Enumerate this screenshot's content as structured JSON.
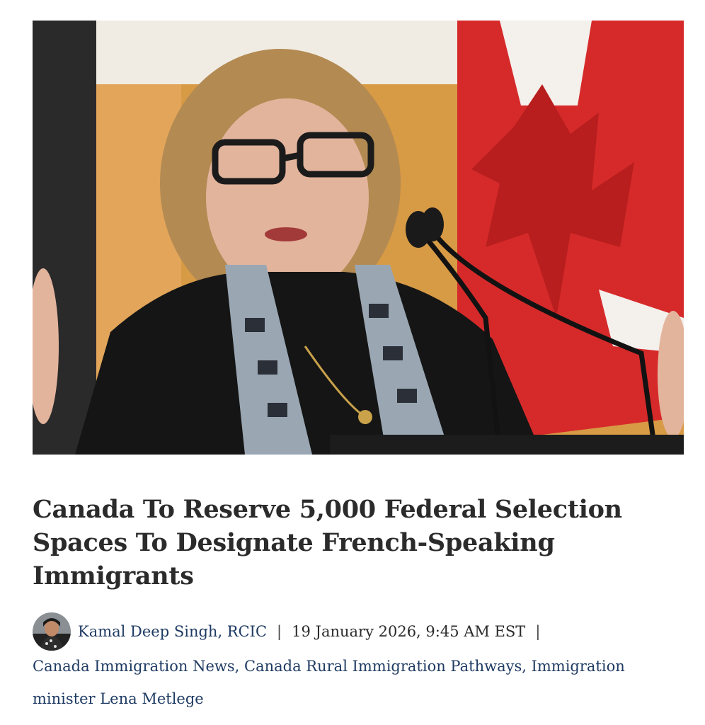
{
  "article": {
    "hero_image_name": "photo-minister-at-podium",
    "headline": "Canada To Reserve 5,000 Federal Selection Spaces To Designate French-Speaking Immigrants",
    "author_avatar_icon": "author-avatar",
    "author": "Kamal Deep Singh, RCIC",
    "separator": "|",
    "date": "19 January 2026, 9:45 AM EST",
    "tags": [
      "Canada Immigration News",
      "Canada Rural Immigration Pathways",
      "Immigration minister Lena Metlege"
    ],
    "tag_separator": ", "
  },
  "colors": {
    "link": "#1f3b63",
    "headline": "#2b2b2b",
    "flag_red": "#d62a2a"
  }
}
